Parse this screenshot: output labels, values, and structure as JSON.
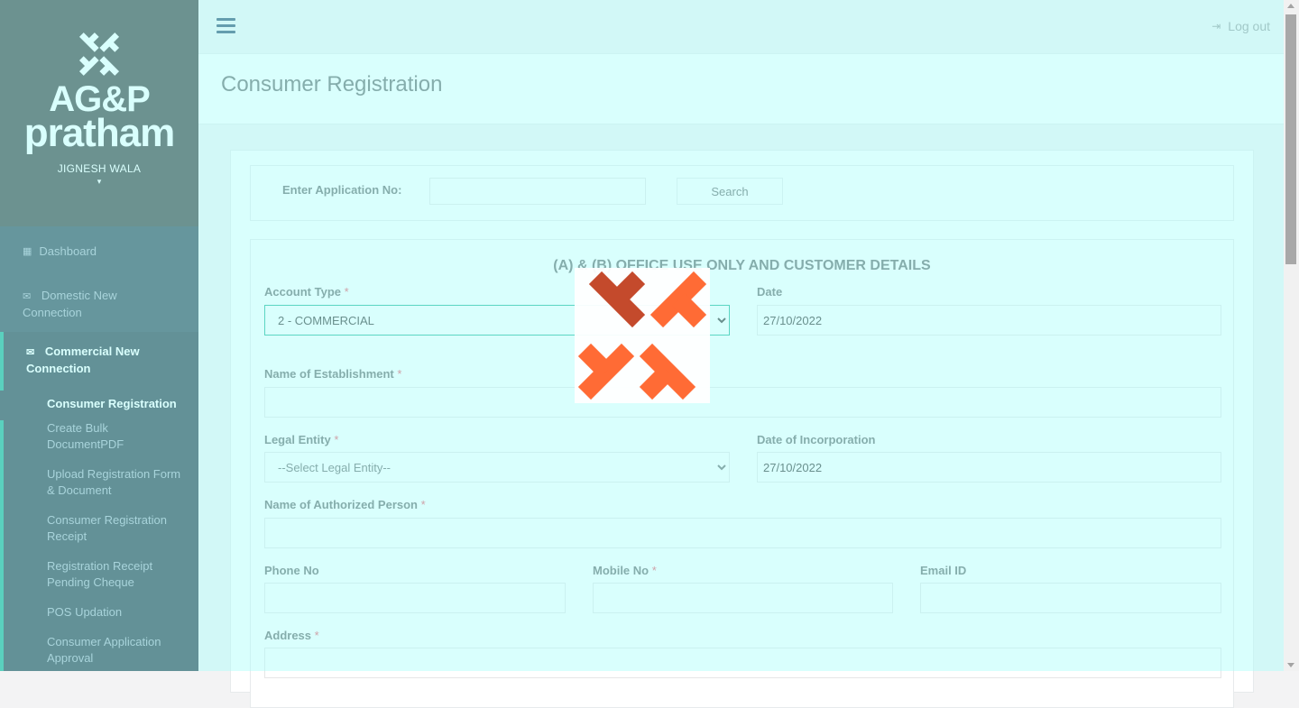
{
  "sidebar": {
    "logo_line1": "AG&P",
    "logo_line2": "pratham",
    "user_name": "JIGNESH WALA",
    "caret": "▾",
    "nav": {
      "dashboard": "Dashboard",
      "domestic": "Domestic New Connection",
      "commercial": "Commercial New Connection"
    },
    "sub_items": [
      "Consumer Registration",
      "Create Bulk DocumentPDF",
      "Upload Registration Form & Document",
      "Consumer Registration Receipt",
      "Registration Receipt Pending Cheque",
      "POS Updation",
      "Consumer Application Approval"
    ]
  },
  "topbar": {
    "logout_label": "Log out",
    "logout_icon": "sign-out-icon",
    "menu_icon": "hamburger-icon"
  },
  "page": {
    "title": "Consumer Registration"
  },
  "search": {
    "label": "Enter Application No:",
    "input_value": "",
    "button_label": "Search"
  },
  "form": {
    "section_title": "(A) & (B) OFFICE USE ONLY AND CUSTOMER DETAILS",
    "account_type": {
      "label": "Account Type",
      "value": "2 - COMMERCIAL"
    },
    "date": {
      "label": "Date",
      "value": "27/10/2022"
    },
    "establishment": {
      "label": "Name of Establishment",
      "value": ""
    },
    "legal_entity": {
      "label": "Legal Entity",
      "value": "--Select Legal Entity--"
    },
    "incorporation_date": {
      "label": "Date of Incorporation",
      "value": "27/10/2022"
    },
    "authorized_person": {
      "label": "Name of Authorized Person",
      "value": ""
    },
    "phone": {
      "label": "Phone No",
      "value": ""
    },
    "mobile": {
      "label": "Mobile No",
      "value": ""
    },
    "email": {
      "label": "Email ID",
      "value": ""
    },
    "address": {
      "label": "Address",
      "value": ""
    },
    "required_mark": "*"
  },
  "colors": {
    "sidebar_bg": "#2f4050",
    "accent": "#19aa8d",
    "overlay": "#aafffa",
    "loader_orange": "#ff6b35",
    "loader_dark": "#c44a2c"
  }
}
